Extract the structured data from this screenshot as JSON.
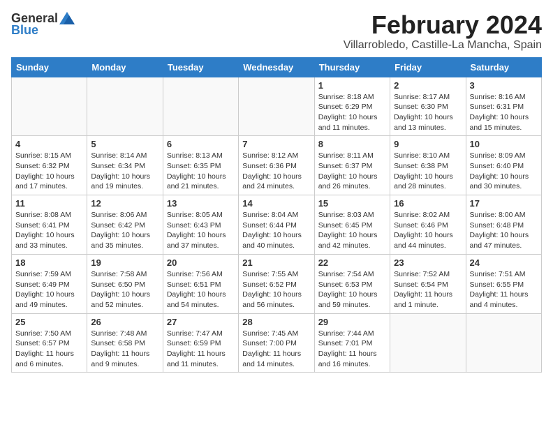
{
  "header": {
    "logo_general": "General",
    "logo_blue": "Blue",
    "title": "February 2024",
    "subtitle": "Villarrobledo, Castille-La Mancha, Spain"
  },
  "days_of_week": [
    "Sunday",
    "Monday",
    "Tuesday",
    "Wednesday",
    "Thursday",
    "Friday",
    "Saturday"
  ],
  "weeks": [
    [
      {
        "day": "",
        "info": ""
      },
      {
        "day": "",
        "info": ""
      },
      {
        "day": "",
        "info": ""
      },
      {
        "day": "",
        "info": ""
      },
      {
        "day": "1",
        "info": "Sunrise: 8:18 AM\nSunset: 6:29 PM\nDaylight: 10 hours\nand 11 minutes."
      },
      {
        "day": "2",
        "info": "Sunrise: 8:17 AM\nSunset: 6:30 PM\nDaylight: 10 hours\nand 13 minutes."
      },
      {
        "day": "3",
        "info": "Sunrise: 8:16 AM\nSunset: 6:31 PM\nDaylight: 10 hours\nand 15 minutes."
      }
    ],
    [
      {
        "day": "4",
        "info": "Sunrise: 8:15 AM\nSunset: 6:32 PM\nDaylight: 10 hours\nand 17 minutes."
      },
      {
        "day": "5",
        "info": "Sunrise: 8:14 AM\nSunset: 6:34 PM\nDaylight: 10 hours\nand 19 minutes."
      },
      {
        "day": "6",
        "info": "Sunrise: 8:13 AM\nSunset: 6:35 PM\nDaylight: 10 hours\nand 21 minutes."
      },
      {
        "day": "7",
        "info": "Sunrise: 8:12 AM\nSunset: 6:36 PM\nDaylight: 10 hours\nand 24 minutes."
      },
      {
        "day": "8",
        "info": "Sunrise: 8:11 AM\nSunset: 6:37 PM\nDaylight: 10 hours\nand 26 minutes."
      },
      {
        "day": "9",
        "info": "Sunrise: 8:10 AM\nSunset: 6:38 PM\nDaylight: 10 hours\nand 28 minutes."
      },
      {
        "day": "10",
        "info": "Sunrise: 8:09 AM\nSunset: 6:40 PM\nDaylight: 10 hours\nand 30 minutes."
      }
    ],
    [
      {
        "day": "11",
        "info": "Sunrise: 8:08 AM\nSunset: 6:41 PM\nDaylight: 10 hours\nand 33 minutes."
      },
      {
        "day": "12",
        "info": "Sunrise: 8:06 AM\nSunset: 6:42 PM\nDaylight: 10 hours\nand 35 minutes."
      },
      {
        "day": "13",
        "info": "Sunrise: 8:05 AM\nSunset: 6:43 PM\nDaylight: 10 hours\nand 37 minutes."
      },
      {
        "day": "14",
        "info": "Sunrise: 8:04 AM\nSunset: 6:44 PM\nDaylight: 10 hours\nand 40 minutes."
      },
      {
        "day": "15",
        "info": "Sunrise: 8:03 AM\nSunset: 6:45 PM\nDaylight: 10 hours\nand 42 minutes."
      },
      {
        "day": "16",
        "info": "Sunrise: 8:02 AM\nSunset: 6:46 PM\nDaylight: 10 hours\nand 44 minutes."
      },
      {
        "day": "17",
        "info": "Sunrise: 8:00 AM\nSunset: 6:48 PM\nDaylight: 10 hours\nand 47 minutes."
      }
    ],
    [
      {
        "day": "18",
        "info": "Sunrise: 7:59 AM\nSunset: 6:49 PM\nDaylight: 10 hours\nand 49 minutes."
      },
      {
        "day": "19",
        "info": "Sunrise: 7:58 AM\nSunset: 6:50 PM\nDaylight: 10 hours\nand 52 minutes."
      },
      {
        "day": "20",
        "info": "Sunrise: 7:56 AM\nSunset: 6:51 PM\nDaylight: 10 hours\nand 54 minutes."
      },
      {
        "day": "21",
        "info": "Sunrise: 7:55 AM\nSunset: 6:52 PM\nDaylight: 10 hours\nand 56 minutes."
      },
      {
        "day": "22",
        "info": "Sunrise: 7:54 AM\nSunset: 6:53 PM\nDaylight: 10 hours\nand 59 minutes."
      },
      {
        "day": "23",
        "info": "Sunrise: 7:52 AM\nSunset: 6:54 PM\nDaylight: 11 hours\nand 1 minute."
      },
      {
        "day": "24",
        "info": "Sunrise: 7:51 AM\nSunset: 6:55 PM\nDaylight: 11 hours\nand 4 minutes."
      }
    ],
    [
      {
        "day": "25",
        "info": "Sunrise: 7:50 AM\nSunset: 6:57 PM\nDaylight: 11 hours\nand 6 minutes."
      },
      {
        "day": "26",
        "info": "Sunrise: 7:48 AM\nSunset: 6:58 PM\nDaylight: 11 hours\nand 9 minutes."
      },
      {
        "day": "27",
        "info": "Sunrise: 7:47 AM\nSunset: 6:59 PM\nDaylight: 11 hours\nand 11 minutes."
      },
      {
        "day": "28",
        "info": "Sunrise: 7:45 AM\nSunset: 7:00 PM\nDaylight: 11 hours\nand 14 minutes."
      },
      {
        "day": "29",
        "info": "Sunrise: 7:44 AM\nSunset: 7:01 PM\nDaylight: 11 hours\nand 16 minutes."
      },
      {
        "day": "",
        "info": ""
      },
      {
        "day": "",
        "info": ""
      }
    ]
  ]
}
